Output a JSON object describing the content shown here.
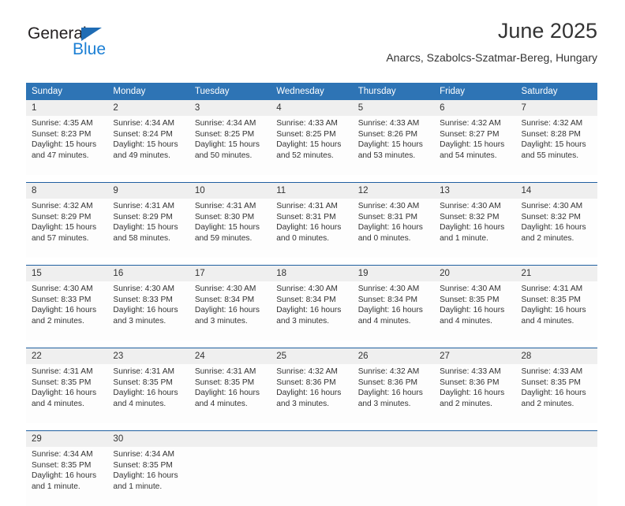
{
  "brand": {
    "name_top": "General",
    "name_bottom": "Blue",
    "accent_color": "#1b7fd4",
    "triangle_color": "#1f6cb4",
    "triangle_icon": "triangle-icon"
  },
  "header": {
    "title": "June 2025",
    "subtitle": "Anarcs, Szabolcs-Szatmar-Bereg, Hungary"
  },
  "theme": {
    "header_bg": "#2e74b5",
    "header_text": "#ffffff",
    "daynum_bg": "#efefef",
    "row_divider": "#1f5fa0",
    "cell_bg": "#fdfdfd",
    "text": "#333333"
  },
  "weekdays": [
    "Sunday",
    "Monday",
    "Tuesday",
    "Wednesday",
    "Thursday",
    "Friday",
    "Saturday"
  ],
  "weeks": [
    [
      {
        "day": "1",
        "sunrise": "Sunrise: 4:35 AM",
        "sunset": "Sunset: 8:23 PM",
        "daylight1": "Daylight: 15 hours",
        "daylight2": "and 47 minutes."
      },
      {
        "day": "2",
        "sunrise": "Sunrise: 4:34 AM",
        "sunset": "Sunset: 8:24 PM",
        "daylight1": "Daylight: 15 hours",
        "daylight2": "and 49 minutes."
      },
      {
        "day": "3",
        "sunrise": "Sunrise: 4:34 AM",
        "sunset": "Sunset: 8:25 PM",
        "daylight1": "Daylight: 15 hours",
        "daylight2": "and 50 minutes."
      },
      {
        "day": "4",
        "sunrise": "Sunrise: 4:33 AM",
        "sunset": "Sunset: 8:25 PM",
        "daylight1": "Daylight: 15 hours",
        "daylight2": "and 52 minutes."
      },
      {
        "day": "5",
        "sunrise": "Sunrise: 4:33 AM",
        "sunset": "Sunset: 8:26 PM",
        "daylight1": "Daylight: 15 hours",
        "daylight2": "and 53 minutes."
      },
      {
        "day": "6",
        "sunrise": "Sunrise: 4:32 AM",
        "sunset": "Sunset: 8:27 PM",
        "daylight1": "Daylight: 15 hours",
        "daylight2": "and 54 minutes."
      },
      {
        "day": "7",
        "sunrise": "Sunrise: 4:32 AM",
        "sunset": "Sunset: 8:28 PM",
        "daylight1": "Daylight: 15 hours",
        "daylight2": "and 55 minutes."
      }
    ],
    [
      {
        "day": "8",
        "sunrise": "Sunrise: 4:32 AM",
        "sunset": "Sunset: 8:29 PM",
        "daylight1": "Daylight: 15 hours",
        "daylight2": "and 57 minutes."
      },
      {
        "day": "9",
        "sunrise": "Sunrise: 4:31 AM",
        "sunset": "Sunset: 8:29 PM",
        "daylight1": "Daylight: 15 hours",
        "daylight2": "and 58 minutes."
      },
      {
        "day": "10",
        "sunrise": "Sunrise: 4:31 AM",
        "sunset": "Sunset: 8:30 PM",
        "daylight1": "Daylight: 15 hours",
        "daylight2": "and 59 minutes."
      },
      {
        "day": "11",
        "sunrise": "Sunrise: 4:31 AM",
        "sunset": "Sunset: 8:31 PM",
        "daylight1": "Daylight: 16 hours",
        "daylight2": "and 0 minutes."
      },
      {
        "day": "12",
        "sunrise": "Sunrise: 4:30 AM",
        "sunset": "Sunset: 8:31 PM",
        "daylight1": "Daylight: 16 hours",
        "daylight2": "and 0 minutes."
      },
      {
        "day": "13",
        "sunrise": "Sunrise: 4:30 AM",
        "sunset": "Sunset: 8:32 PM",
        "daylight1": "Daylight: 16 hours",
        "daylight2": "and 1 minute."
      },
      {
        "day": "14",
        "sunrise": "Sunrise: 4:30 AM",
        "sunset": "Sunset: 8:32 PM",
        "daylight1": "Daylight: 16 hours",
        "daylight2": "and 2 minutes."
      }
    ],
    [
      {
        "day": "15",
        "sunrise": "Sunrise: 4:30 AM",
        "sunset": "Sunset: 8:33 PM",
        "daylight1": "Daylight: 16 hours",
        "daylight2": "and 2 minutes."
      },
      {
        "day": "16",
        "sunrise": "Sunrise: 4:30 AM",
        "sunset": "Sunset: 8:33 PM",
        "daylight1": "Daylight: 16 hours",
        "daylight2": "and 3 minutes."
      },
      {
        "day": "17",
        "sunrise": "Sunrise: 4:30 AM",
        "sunset": "Sunset: 8:34 PM",
        "daylight1": "Daylight: 16 hours",
        "daylight2": "and 3 minutes."
      },
      {
        "day": "18",
        "sunrise": "Sunrise: 4:30 AM",
        "sunset": "Sunset: 8:34 PM",
        "daylight1": "Daylight: 16 hours",
        "daylight2": "and 3 minutes."
      },
      {
        "day": "19",
        "sunrise": "Sunrise: 4:30 AM",
        "sunset": "Sunset: 8:34 PM",
        "daylight1": "Daylight: 16 hours",
        "daylight2": "and 4 minutes."
      },
      {
        "day": "20",
        "sunrise": "Sunrise: 4:30 AM",
        "sunset": "Sunset: 8:35 PM",
        "daylight1": "Daylight: 16 hours",
        "daylight2": "and 4 minutes."
      },
      {
        "day": "21",
        "sunrise": "Sunrise: 4:31 AM",
        "sunset": "Sunset: 8:35 PM",
        "daylight1": "Daylight: 16 hours",
        "daylight2": "and 4 minutes."
      }
    ],
    [
      {
        "day": "22",
        "sunrise": "Sunrise: 4:31 AM",
        "sunset": "Sunset: 8:35 PM",
        "daylight1": "Daylight: 16 hours",
        "daylight2": "and 4 minutes."
      },
      {
        "day": "23",
        "sunrise": "Sunrise: 4:31 AM",
        "sunset": "Sunset: 8:35 PM",
        "daylight1": "Daylight: 16 hours",
        "daylight2": "and 4 minutes."
      },
      {
        "day": "24",
        "sunrise": "Sunrise: 4:31 AM",
        "sunset": "Sunset: 8:35 PM",
        "daylight1": "Daylight: 16 hours",
        "daylight2": "and 4 minutes."
      },
      {
        "day": "25",
        "sunrise": "Sunrise: 4:32 AM",
        "sunset": "Sunset: 8:36 PM",
        "daylight1": "Daylight: 16 hours",
        "daylight2": "and 3 minutes."
      },
      {
        "day": "26",
        "sunrise": "Sunrise: 4:32 AM",
        "sunset": "Sunset: 8:36 PM",
        "daylight1": "Daylight: 16 hours",
        "daylight2": "and 3 minutes."
      },
      {
        "day": "27",
        "sunrise": "Sunrise: 4:33 AM",
        "sunset": "Sunset: 8:36 PM",
        "daylight1": "Daylight: 16 hours",
        "daylight2": "and 2 minutes."
      },
      {
        "day": "28",
        "sunrise": "Sunrise: 4:33 AM",
        "sunset": "Sunset: 8:35 PM",
        "daylight1": "Daylight: 16 hours",
        "daylight2": "and 2 minutes."
      }
    ],
    [
      {
        "day": "29",
        "sunrise": "Sunrise: 4:34 AM",
        "sunset": "Sunset: 8:35 PM",
        "daylight1": "Daylight: 16 hours",
        "daylight2": "and 1 minute."
      },
      {
        "day": "30",
        "sunrise": "Sunrise: 4:34 AM",
        "sunset": "Sunset: 8:35 PM",
        "daylight1": "Daylight: 16 hours",
        "daylight2": "and 1 minute."
      },
      {
        "day": "",
        "sunrise": "",
        "sunset": "",
        "daylight1": "",
        "daylight2": ""
      },
      {
        "day": "",
        "sunrise": "",
        "sunset": "",
        "daylight1": "",
        "daylight2": ""
      },
      {
        "day": "",
        "sunrise": "",
        "sunset": "",
        "daylight1": "",
        "daylight2": ""
      },
      {
        "day": "",
        "sunrise": "",
        "sunset": "",
        "daylight1": "",
        "daylight2": ""
      },
      {
        "day": "",
        "sunrise": "",
        "sunset": "",
        "daylight1": "",
        "daylight2": ""
      }
    ]
  ]
}
